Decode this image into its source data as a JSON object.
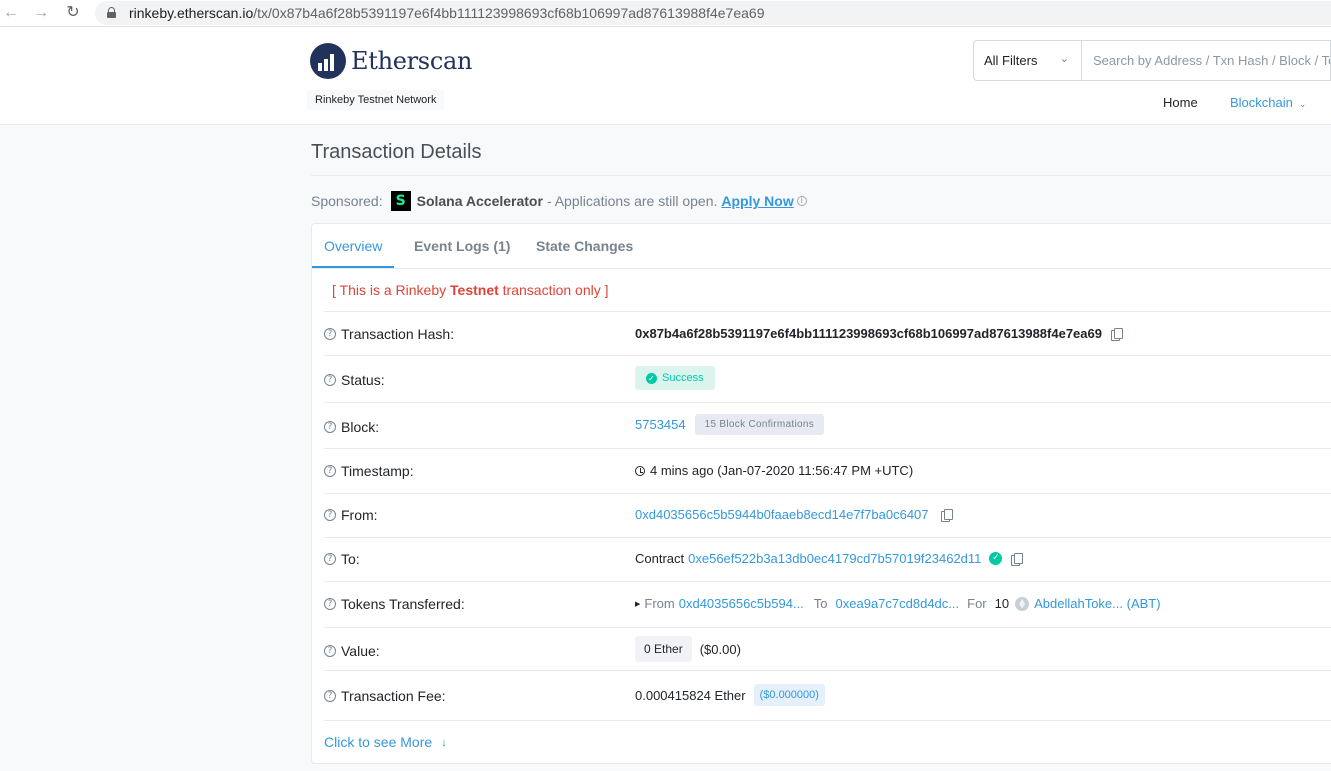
{
  "browser": {
    "url_host": "rinkeby.etherscan.io",
    "url_path": "/tx/0x87b4a6f28b5391197e6f4bb111123998693cf68b106997ad87613988f4e7ea69"
  },
  "header": {
    "logo_text": "Etherscan",
    "network_badge": "Rinkeby Testnet Network",
    "filter_label": "All Filters",
    "search_placeholder": "Search by Address / Txn Hash / Block / Token / Ens",
    "menu": {
      "home": "Home",
      "blockchain": "Blockchain"
    }
  },
  "page": {
    "title": "Transaction Details",
    "sponsor": {
      "prefix": "Sponsored:",
      "logo_letter": "S",
      "name": "Solana Accelerator",
      "text": "- Applications are still open.",
      "cta": "Apply Now",
      "info_icon": "i"
    }
  },
  "tabs": [
    {
      "label": "Overview",
      "active": true
    },
    {
      "label": "Event Logs (1)",
      "active": false
    },
    {
      "label": "State Changes",
      "active": false
    }
  ],
  "testnet_note": {
    "prefix": "[ This is a Rinkeby ",
    "bold": "Testnet",
    "suffix": " transaction only ]"
  },
  "details": {
    "hash": {
      "label": "Transaction Hash:",
      "value": "0x87b4a6f28b5391197e6f4bb111123998693cf68b106997ad87613988f4e7ea69"
    },
    "status": {
      "label": "Status:",
      "value": "Success"
    },
    "block": {
      "label": "Block:",
      "value": "5753454",
      "confirmations": "15 Block Confirmations"
    },
    "timestamp": {
      "label": "Timestamp:",
      "value": "4 mins ago (Jan-07-2020 11:56:47 PM +UTC)"
    },
    "from": {
      "label": "From:",
      "value": "0xd4035656c5b5944b0faaeb8ecd14e7f7ba0c6407"
    },
    "to": {
      "label": "To:",
      "prefix": "Contract",
      "value": "0xe56ef522b3a13db0ec4179cd7b57019f23462d11"
    },
    "tokens": {
      "label": "Tokens Transferred:",
      "from_label": "From",
      "from_value": "0xd4035656c5b594...",
      "to_label": "To",
      "to_value": "0xea9a7c7cd8d4dc...",
      "for_label": "For",
      "amount": "10",
      "token": "AbdellahToke... (ABT)"
    },
    "value": {
      "label": "Value:",
      "amount": "0 Ether",
      "usd": "($0.00)"
    },
    "fee": {
      "label": "Transaction Fee:",
      "amount": "0.000415824 Ether",
      "usd": "($0.000000)"
    }
  },
  "see_more": {
    "label": "Click to see More",
    "arrow": "↓"
  },
  "colors": {
    "accent": "#3498db",
    "success": "#00c9a7",
    "danger": "#de4437",
    "brand": "#21325b"
  }
}
